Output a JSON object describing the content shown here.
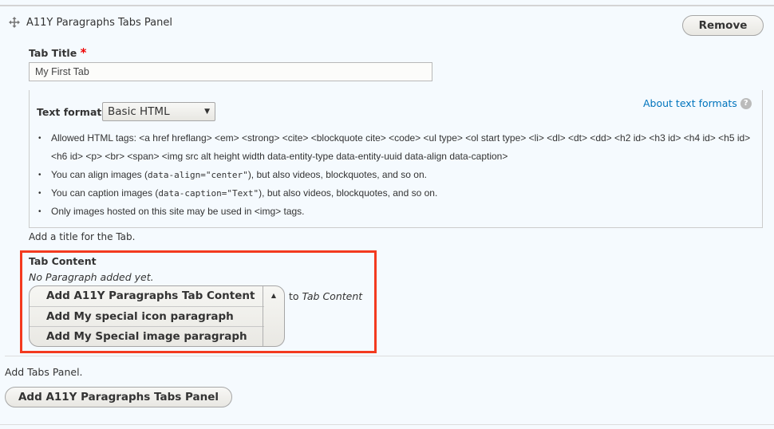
{
  "panel": {
    "title": "A11Y Paragraphs Tabs Panel",
    "remove_label": "Remove"
  },
  "tab_title": {
    "label": "Tab Title",
    "required_mark": "*",
    "value": "My First Tab",
    "description": "Add a title for the Tab."
  },
  "text_format": {
    "label": "Text format",
    "selected": "Basic HTML",
    "about_link": "About text formats",
    "tips": [
      {
        "text": "Allowed HTML tags: <a href hreflang> <em> <strong> <cite> <blockquote cite> <code> <ul type> <ol start type> <li> <dl> <dt> <dd> <h2 id> <h3 id> <h4 id> <h5 id> <h6 id> <p> <br> <span> <img src alt height width data-entity-type data-entity-uuid data-align data-caption>"
      },
      {
        "pre": "You can align images (",
        "code": "data-align=\"center\"",
        "post": "), but also videos, blockquotes, and so on."
      },
      {
        "pre": "You can caption images (",
        "code": "data-caption=\"Text\"",
        "post": "), but also videos, blockquotes, and so on."
      },
      {
        "text": "Only images hosted on this site may be used in <img> tags."
      }
    ]
  },
  "tab_content": {
    "label": "Tab Content",
    "empty": "No Paragraph added yet.",
    "add_options": [
      "Add A11Y Paragraphs Tab Content",
      "Add My special icon paragraph",
      "Add My Special image paragraph"
    ],
    "to_prefix": "to",
    "to_target": "Tab Content"
  },
  "footer": {
    "description": "Add Tabs Panel.",
    "add_button": "Add A11Y Paragraphs Tabs Panel"
  },
  "colors": {
    "highlight": "#f33a1f",
    "link": "#0074bd",
    "required": "#e00"
  }
}
